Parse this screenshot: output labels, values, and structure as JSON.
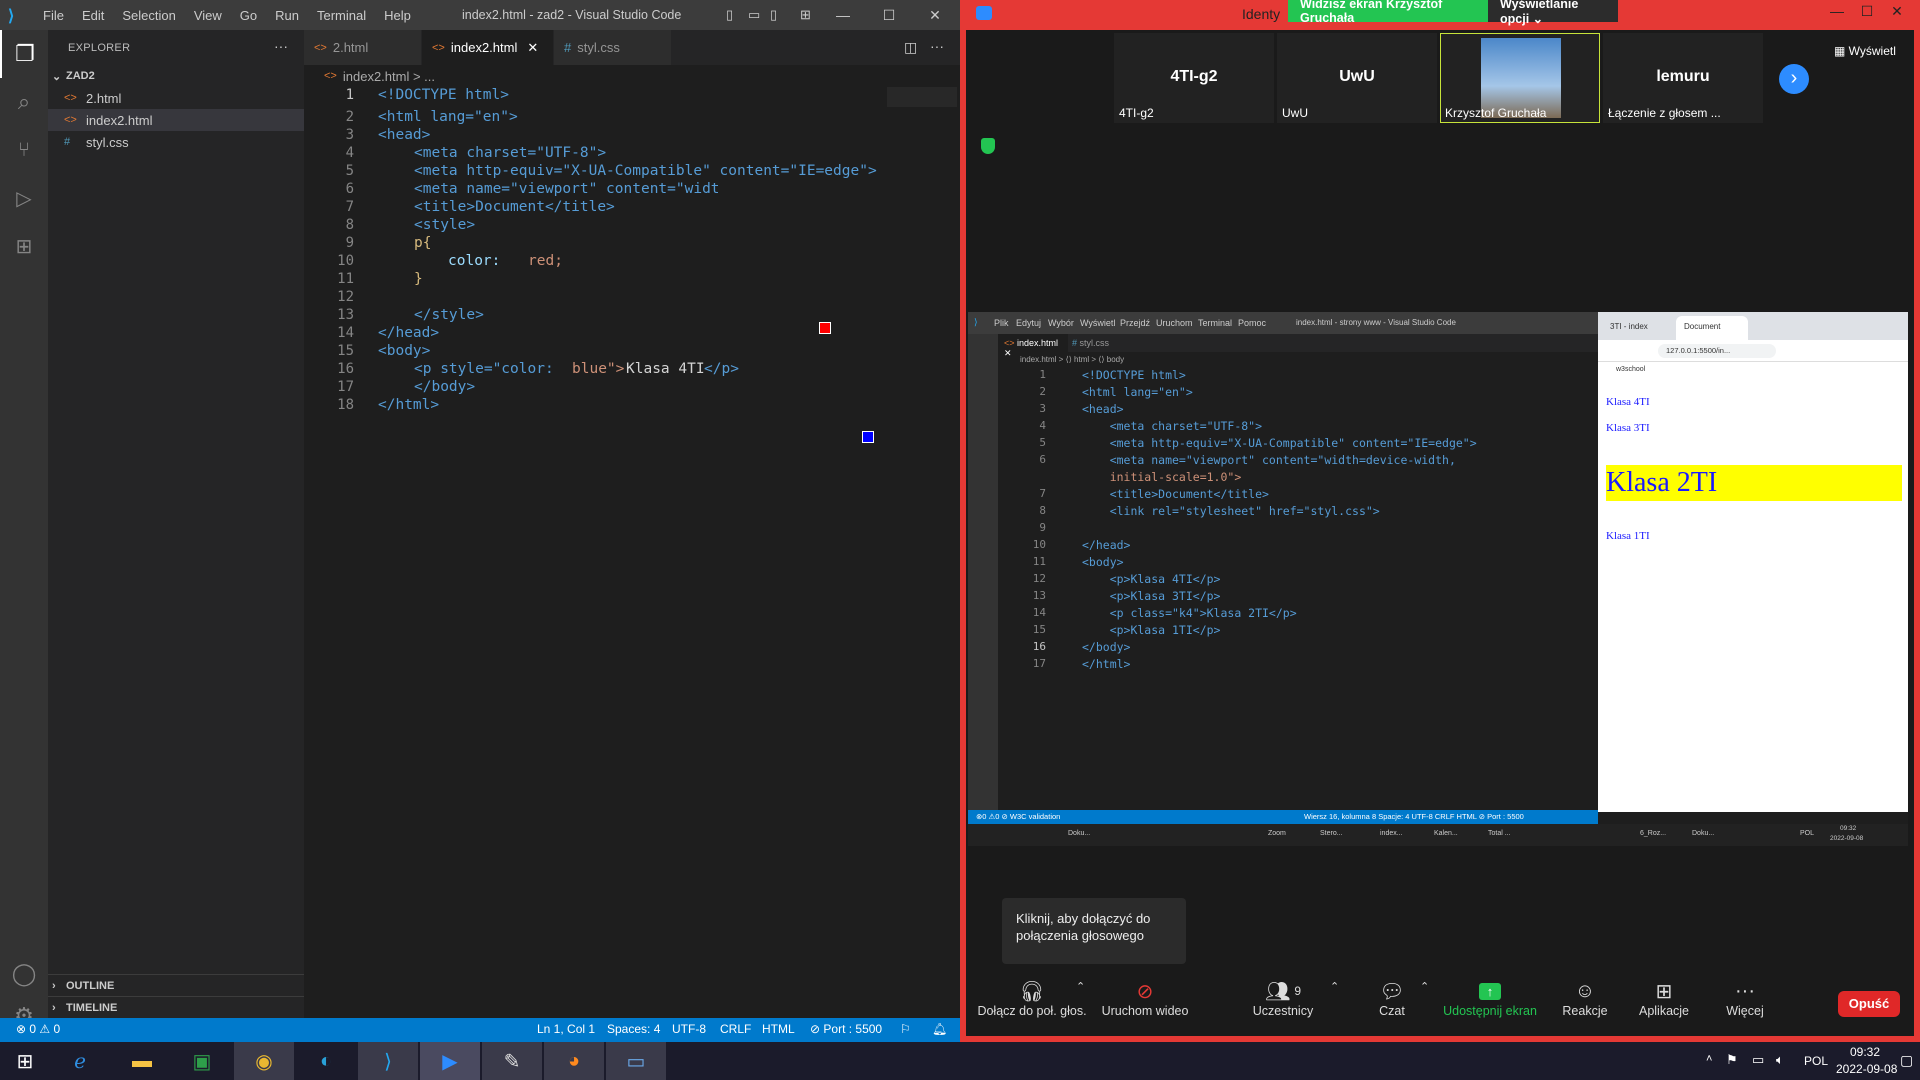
{
  "vscode": {
    "menu": [
      "File",
      "Edit",
      "Selection",
      "View",
      "Go",
      "Run",
      "Terminal",
      "Help"
    ],
    "title": "index2.html - zad2 - Visual Studio Code",
    "explorer_title": "EXPLORER",
    "folder": "ZAD2",
    "files": [
      "2.html",
      "index2.html",
      "styl.css"
    ],
    "outline": "OUTLINE",
    "timeline": "TIMELINE",
    "tabs": [
      "2.html",
      "index2.html",
      "styl.css"
    ],
    "breadcrumb": "index2.html > ...",
    "lines": [
      "1",
      "2",
      "3",
      "4",
      "5",
      "6",
      "7",
      "8",
      "9",
      "10",
      "11",
      "12",
      "13",
      "14",
      "15",
      "16",
      "17",
      "18"
    ],
    "code": {
      "l1a": "<!",
      "l1b": "DOCTYPE",
      "l1c": " html",
      ">": ">",
      "doctype": "<!DOCTYPE html>",
      "l2": "<html lang=\"en\">",
      "l3": "<head>",
      "l4": "<meta charset=\"UTF-8\">",
      "l5": "<meta http-equiv=\"X-UA-Compatible\" content=\"IE=edge\">",
      "l6": "<meta name=\"viewport\" content=\"width=device-width, in",
      "l7": "<title>Document</title>",
      "l8": "<style>",
      "l9": "p{",
      "l10_prop": "color: ",
      "l10_val": "red;",
      "l11": "}",
      "l13": "</style>",
      "l14": "</head>",
      "l15": "<body>",
      "l16_a": "<p style=\"color:",
      "l16_b": "blue\">",
      "l16_c": "Klasa 4TI",
      "l16_d": "</p>",
      "l17": "</body>",
      "l18": "</html>"
    },
    "status": {
      "errors": "⊗ 0 ⚠ 0",
      "position": "Ln 1, Col 1",
      "spaces": "Spaces: 4",
      "encoding": "UTF-8",
      "eol": "CRLF",
      "language": "HTML",
      "port": "⊘ Port : 5500"
    }
  },
  "zoom": {
    "title_partial": "Identy",
    "banner": "Widzisz ekran Krzysztof Gruchała",
    "view_options": "Wyświetlanie opcji ⌄",
    "view_btn": "Wyświetl",
    "participants": [
      {
        "big": "4TI-g2",
        "small": "4TI-g2"
      },
      {
        "big": "UwU",
        "small": "UwU"
      },
      {
        "big": "",
        "small": "Krzysztof Gruchała"
      },
      {
        "big": "lemuru",
        "small": "Łączenie z głosem ..."
      }
    ],
    "tooltip": "Kliknij, aby dołączyć do połączenia głosowego",
    "controls": [
      {
        "label": "Dołącz do poł. głos.",
        "icon": "headphones-icon"
      },
      {
        "label": "Uruchom wideo",
        "icon": "video-off-icon"
      },
      {
        "label": "Uczestnicy",
        "icon": "participants-icon",
        "count": "9"
      },
      {
        "label": "Czat",
        "icon": "chat-icon"
      },
      {
        "label": "Udostępnij ekran",
        "icon": "share-icon"
      },
      {
        "label": "Reakcje",
        "icon": "reaction-icon"
      },
      {
        "label": "Aplikacje",
        "icon": "apps-icon"
      },
      {
        "label": "Więcej",
        "icon": "more-icon"
      }
    ],
    "leave": "Opuść",
    "accent": "#e53935"
  },
  "shared": {
    "menu": [
      "Plik",
      "Edytuj",
      "Wybór",
      "Wyświetl",
      "Przejdź",
      "Uruchom",
      "Terminal",
      "Pomoc"
    ],
    "title": "index.html - strony www - Visual Studio Code",
    "tabs": [
      "index.html",
      "styl.css"
    ],
    "breadcrumb": "index.html > ⟨⟩ html > ⟨⟩ body",
    "lines": [
      "1",
      "2",
      "3",
      "4",
      "5",
      "6",
      "",
      "7",
      "8",
      "9",
      "10",
      "11",
      "12",
      "13",
      "14",
      "15",
      "16",
      "17"
    ],
    "code": [
      "<!DOCTYPE html>",
      "<html lang=\"en\">",
      "<head>",
      "    <meta charset=\"UTF-8\">",
      "    <meta http-equiv=\"X-UA-Compatible\" content=\"IE=edge\">",
      "    <meta name=\"viewport\" content=\"width=device-width,",
      "    initial-scale=1.0\">",
      "    <title>Document</title>",
      "    <link rel=\"stylesheet\" href=\"styl.css\">",
      "",
      "</head>",
      "<body>",
      "    <p>Klasa 4TI</p>",
      "    <p>Klasa 3TI</p>",
      "    <p class=\"k4\">Klasa 2TI</p>",
      "    <p>Klasa 1TI</p>",
      "</body>",
      "</html>"
    ],
    "status": "⊗0 ⚠0    ⊘ W3C validation",
    "status_right": "Wiersz 16, kolumna 8   Spacje: 4   UTF-8   CRLF   HTML   ⊘ Port : 5500",
    "browser": {
      "tab1": "3TI - index",
      "tab2": "Document",
      "url": "127.0.0.1:5500/in...",
      "bookmark": "w3school",
      "items": [
        "Klasa 4TI",
        "Klasa 3TI",
        "Klasa 2TI",
        "Klasa 1TI"
      ]
    },
    "task_labels": [
      "Doku...",
      "Zoom",
      "Stero...",
      "index...",
      "Kalen...",
      "Total ...",
      "6_Roz...",
      "Doku..."
    ],
    "time": "09:32",
    "date": "2022-09-08",
    "lang": "POL"
  },
  "taskbar": {
    "apps": [
      "windows-icon",
      "ie-icon",
      "files-icon",
      "store-icon",
      "chrome-icon",
      "edge-icon",
      "vscode-icon",
      "zoom-icon",
      "paint-icon",
      "firefox-icon",
      "photos-icon"
    ],
    "lang": "POL",
    "time": "09:32",
    "date": "2022-09-08"
  }
}
